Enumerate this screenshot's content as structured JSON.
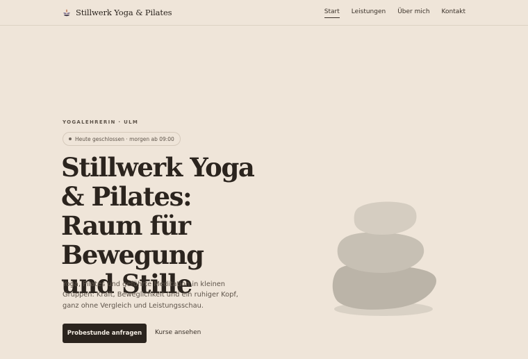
{
  "header": {
    "brand_name": "Stillwerk Yoga & Pilates",
    "brand_icon": "lotus-icon",
    "nav": [
      {
        "label": "Start",
        "active": true
      },
      {
        "label": "Leistungen",
        "active": false
      },
      {
        "label": "Über mich",
        "active": false
      },
      {
        "label": "Kontakt",
        "active": false
      }
    ]
  },
  "hero": {
    "eyebrow": "YOGALEHRERIN · ULM",
    "status": "Heute geschlossen · morgen ab 09:00",
    "title": "Stillwerk Yoga & Pilates: Raum für Bewegung und Stille",
    "text": "Yoga, Pilates und geführte Meditation in kleinen Gruppen: Kraft, Beweglichkeit und ein ruhiger Kopf, ganz ohne Vergleich und Leistungsschau.",
    "cta_primary": "Probestunde anfragen",
    "cta_secondary": "Kurse ansehen"
  },
  "illustration": {
    "icon": "stacked-stones-illustration"
  },
  "colors": {
    "background": "#efe5d9",
    "text": "#2b241e",
    "muted": "#5e544a",
    "stone_light": "#d5cdc1",
    "stone_mid": "#c7c0b4",
    "stone_dark": "#bbb4a8"
  }
}
